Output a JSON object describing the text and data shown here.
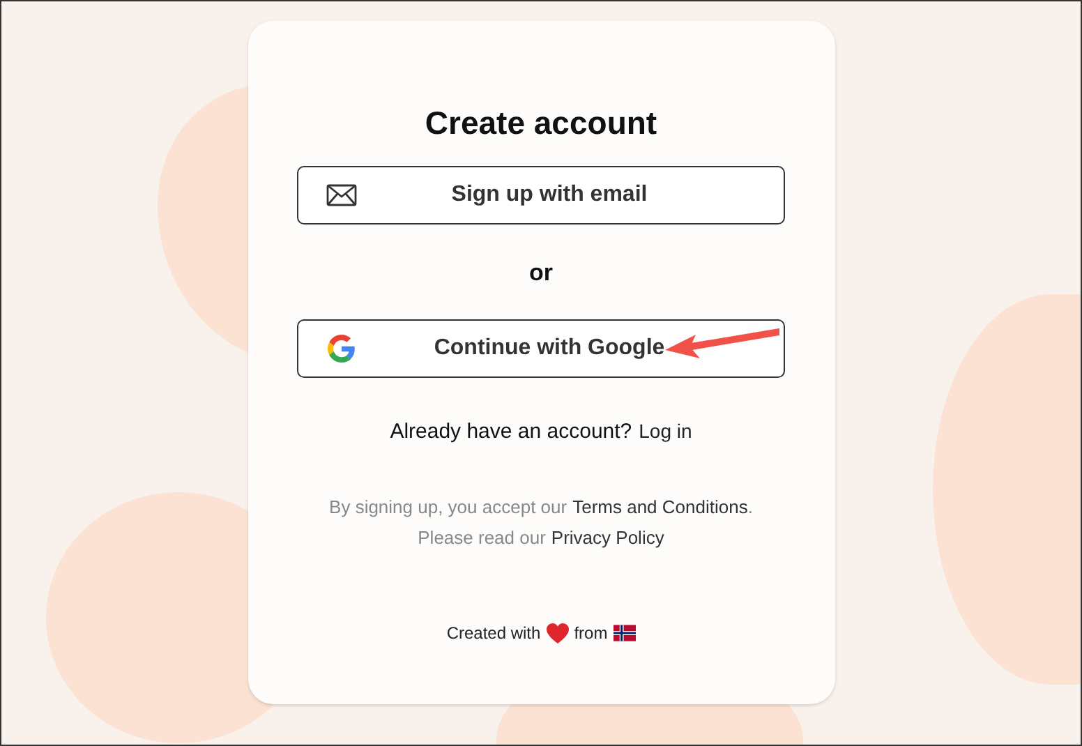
{
  "title": "Create account",
  "buttons": [
    {
      "kind": "email",
      "label": "Sign up with email"
    },
    {
      "kind": "google",
      "label": "Continue with Google",
      "highlighted": true
    }
  ],
  "divider_text": "or",
  "login": {
    "prompt": "Already have an account?",
    "link": "Log in"
  },
  "legal": {
    "terms_prefix": "By signing up, you accept our",
    "terms_link": "Terms and Conditions",
    "terms_suffix": ".",
    "privacy_prefix": "Please read our",
    "privacy_link": "Privacy Policy"
  },
  "footer": {
    "before": "Created with",
    "after": "from"
  }
}
